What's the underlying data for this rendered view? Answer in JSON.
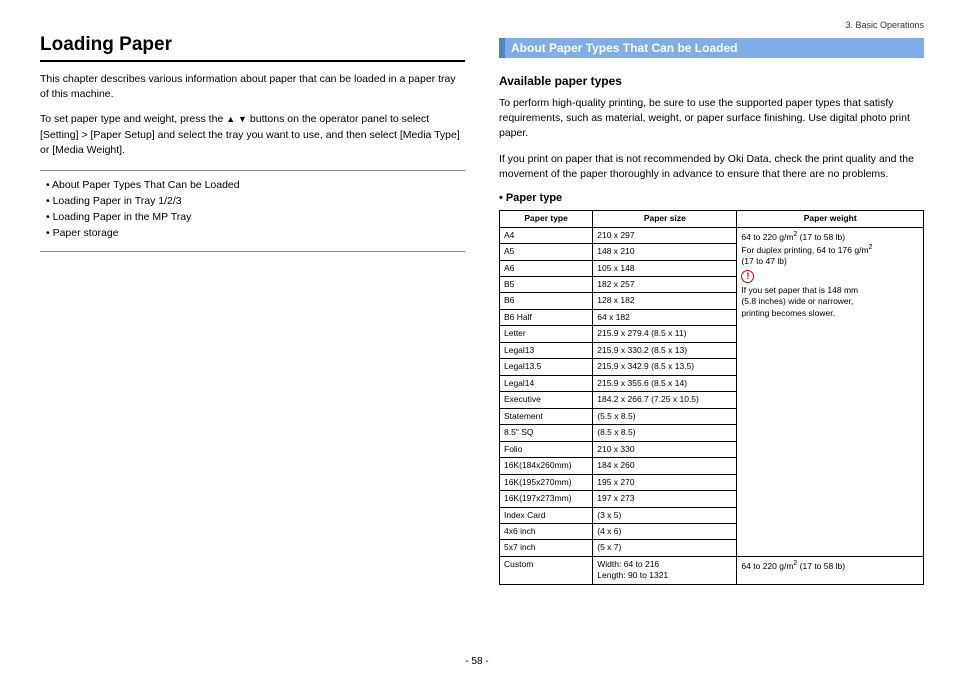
{
  "breadcrumb": "3. Basic Operations",
  "page_number": "- 58 -",
  "left": {
    "title": "Loading Paper",
    "intro": "This chapter describes various information about paper that can be loaded in a paper tray of this machine.",
    "setup_pre": "To set paper type and weight, press the ",
    "setup_post": " buttons on the operator panel to select [Setting] > [Paper Setup] and select the tray you want to use, and then select [Media Type] or [Media Weight].",
    "toc": [
      "About Paper Types That Can be Loaded",
      "Loading Paper in Tray 1/2/3",
      "Loading Paper in the MP Tray",
      "Paper storage"
    ]
  },
  "right": {
    "section_title": "About Paper Types That Can be Loaded",
    "subhead": "Available paper types",
    "para1": "To perform high-quality printing, be sure to use the supported paper types that satisfy requirements, such as material, weight, or paper surface finishing. Use digital photo print paper.",
    "para2": "If you print on paper that is not recommended by Oki Data, check the print quality and the movement of the paper thoroughly in advance to ensure that there are no problems.",
    "table_head": "Paper type",
    "headers": {
      "c1": "Paper type",
      "c2": "Paper size",
      "c3": "Paper weight"
    },
    "weight_cell": {
      "l1": "64 to 220 g/m",
      "l1b": " (17 to 58 lb)",
      "l2": "For duplex printing, 64 to 176 g/m",
      "l3": "(17 to 47 lb)",
      "note1": "If you set paper that is 148 mm",
      "note2": "(5.8 inches) wide or narrower,",
      "note3": "printing becomes slower."
    },
    "custom_weight": "64 to 220 g/m",
    "custom_weight_b": " (17 to 58 lb)",
    "rows": [
      {
        "t": "A4",
        "s": "210 x 297"
      },
      {
        "t": "A5",
        "s": "148 x 210"
      },
      {
        "t": "A6",
        "s": "105 x 148"
      },
      {
        "t": "B5",
        "s": "182 x 257"
      },
      {
        "t": "B6",
        "s": "128 x 182"
      },
      {
        "t": "B6 Half",
        "s": "64 x 182"
      },
      {
        "t": "Letter",
        "s": "215.9 x 279.4 (8.5 x 11)"
      },
      {
        "t": "Legal13",
        "s": "215.9 x 330.2 (8.5 x 13)"
      },
      {
        "t": "Legal13.5",
        "s": "215.9 x 342.9 (8.5 x 13.5)"
      },
      {
        "t": "Legal14",
        "s": "215.9 x 355.6 (8.5 x 14)"
      },
      {
        "t": "Executive",
        "s": "184.2 x 266.7 (7.25 x 10.5)"
      },
      {
        "t": "Statement",
        "s": "(5.5 x 8.5)"
      },
      {
        "t": "8.5\" SQ",
        "s": "(8.5 x 8.5)"
      },
      {
        "t": "Folio",
        "s": "210 x 330"
      },
      {
        "t": "16K(184x260mm)",
        "s": "184 x 260"
      },
      {
        "t": "16K(195x270mm)",
        "s": "195 x 270"
      },
      {
        "t": "16K(197x273mm)",
        "s": "197 x 273"
      },
      {
        "t": "Index Card",
        "s": "(3 x 5)"
      },
      {
        "t": "4x6 inch",
        "s": "(4 x 6)"
      },
      {
        "t": "5x7 inch",
        "s": "(5 x 7)"
      }
    ],
    "custom": {
      "t": "Custom",
      "s1": "Width: 64 to 216",
      "s2": "Length: 90 to 1321"
    }
  }
}
